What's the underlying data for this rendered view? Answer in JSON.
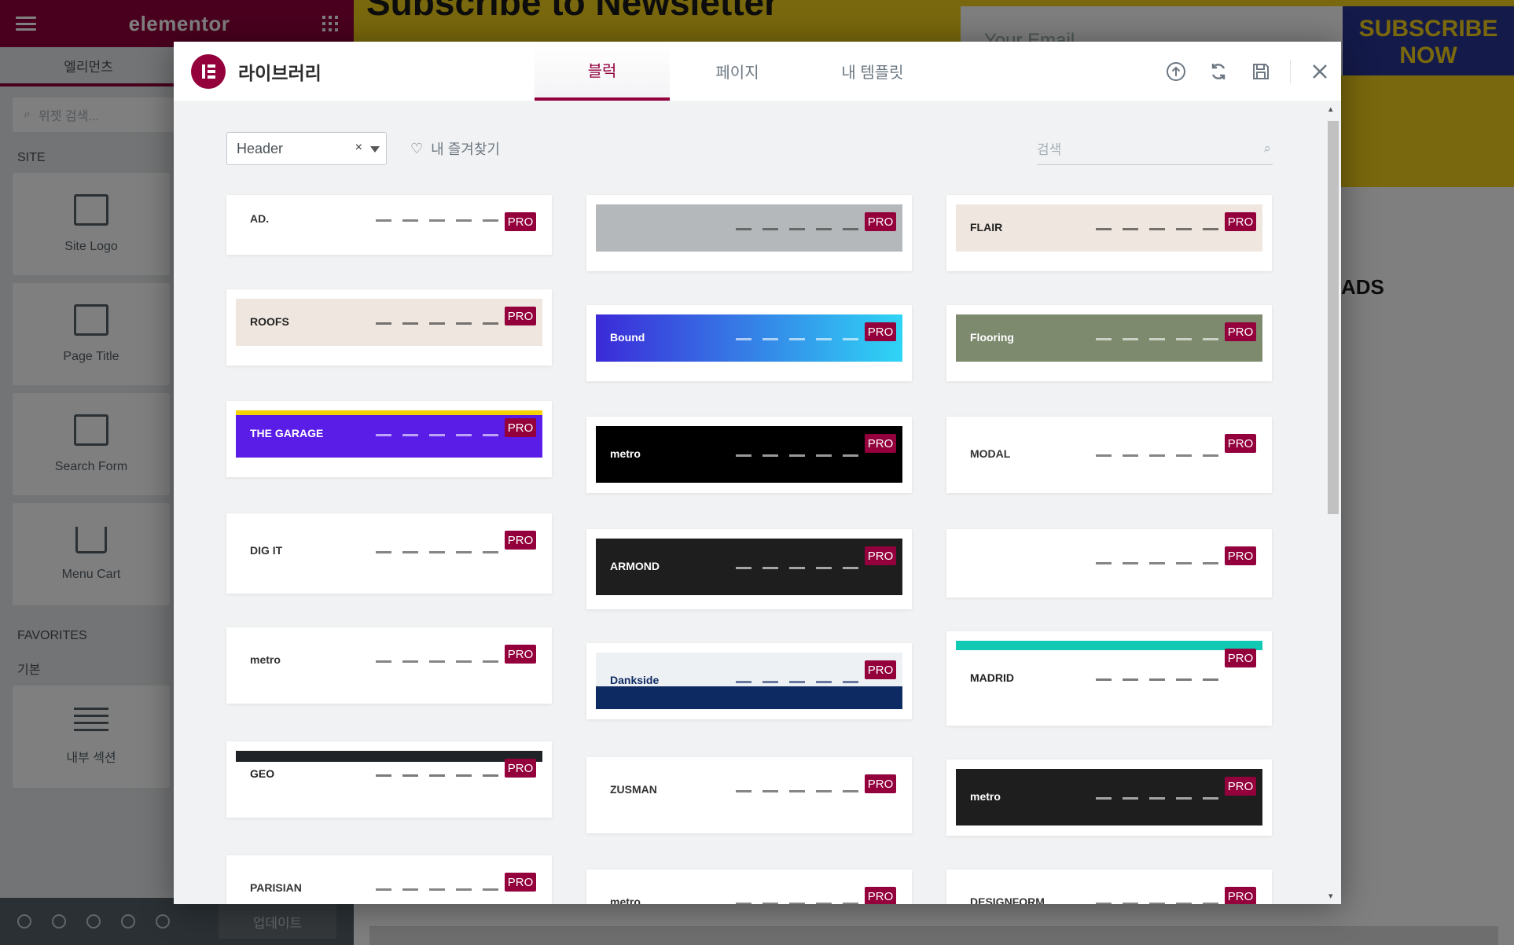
{
  "editor": {
    "brand": "elementor",
    "panel_tab_elements": "엘리먼츠",
    "search_placeholder": "위젯 검색...",
    "section_site": "SITE",
    "section_favorites": "FAVORITES",
    "section_basic": "기본",
    "widgets": [
      {
        "label": "Site Logo"
      },
      {
        "label": "Page Title"
      },
      {
        "label": "Search Form"
      },
      {
        "label": "Menu Cart"
      },
      {
        "label": "내부 섹션"
      }
    ],
    "update_label": "업데이트"
  },
  "canvas": {
    "newsletter_title": "Subscribe to Newsletter",
    "email_placeholder": "Your Email",
    "subscribe_label": "SUBSCRIBE NOW",
    "side_text": "ADS"
  },
  "library": {
    "title": "라이브러리",
    "tabs": [
      {
        "label": "블럭",
        "active": true
      },
      {
        "label": "페이지",
        "active": false
      },
      {
        "label": "내 템플릿",
        "active": false
      }
    ],
    "filter_value": "Header",
    "favorites_label": "내 즐겨찾기",
    "search_placeholder": "검색",
    "badge": "PRO",
    "accent": "#93003c",
    "templates": [
      {
        "logo": "AD.",
        "theme": "light"
      },
      {
        "logo": "",
        "theme": "gray-bar"
      },
      {
        "logo": "FLAIR",
        "theme": "cream"
      },
      {
        "logo": "ROOFS",
        "theme": "cream"
      },
      {
        "logo": "Bound",
        "theme": "blue-gradient"
      },
      {
        "logo": "Flooring",
        "theme": "olive"
      },
      {
        "logo": "THE GARAGE",
        "theme": "purple"
      },
      {
        "logo": "metro",
        "theme": "black"
      },
      {
        "logo": "MODAL",
        "theme": "light"
      },
      {
        "logo": "DIG IT",
        "theme": "light"
      },
      {
        "logo": "ARMOND",
        "theme": "dark"
      },
      {
        "logo": "",
        "theme": "light"
      },
      {
        "logo": "metro",
        "theme": "light"
      },
      {
        "logo": "Dankside",
        "theme": "navy"
      },
      {
        "logo": "MADRID",
        "theme": "teal"
      },
      {
        "logo": "GEO",
        "theme": "light-dark"
      },
      {
        "logo": "ZUSMAN",
        "theme": "light"
      },
      {
        "logo": "metro",
        "theme": "dark"
      },
      {
        "logo": "PARISIAN",
        "theme": "light"
      },
      {
        "logo": "metro",
        "theme": "light"
      },
      {
        "logo": "DESIGNFORM",
        "theme": "light"
      }
    ]
  }
}
